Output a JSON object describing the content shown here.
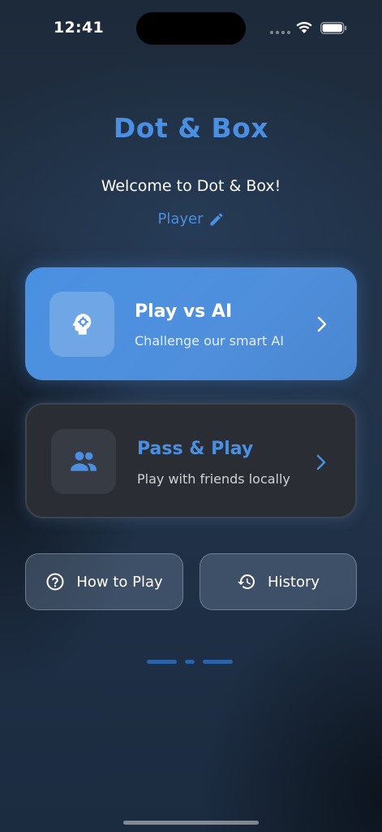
{
  "status_bar": {
    "time": "12:41",
    "icons": [
      "signal-dots-icon",
      "wifi-icon",
      "battery-icon"
    ]
  },
  "header": {
    "title": "Dot & Box",
    "welcome": "Welcome to Dot & Box!",
    "player_name": "Player",
    "edit_icon": "pencil-icon"
  },
  "modes": {
    "ai": {
      "title": "Play vs AI",
      "subtitle": "Challenge our smart AI",
      "icon": "brain-head-icon"
    },
    "pass": {
      "title": "Pass & Play",
      "subtitle": "Play with friends locally",
      "icon": "people-icon"
    }
  },
  "buttons": {
    "how_to_play": {
      "label": "How to Play",
      "icon": "help-circle-icon"
    },
    "history": {
      "label": "History",
      "icon": "history-icon"
    }
  },
  "colors": {
    "accent": "#4a8fe2",
    "ai_card": "#4a90e2",
    "pass_card": "#2a2d33",
    "background": "#1d2a3a"
  }
}
